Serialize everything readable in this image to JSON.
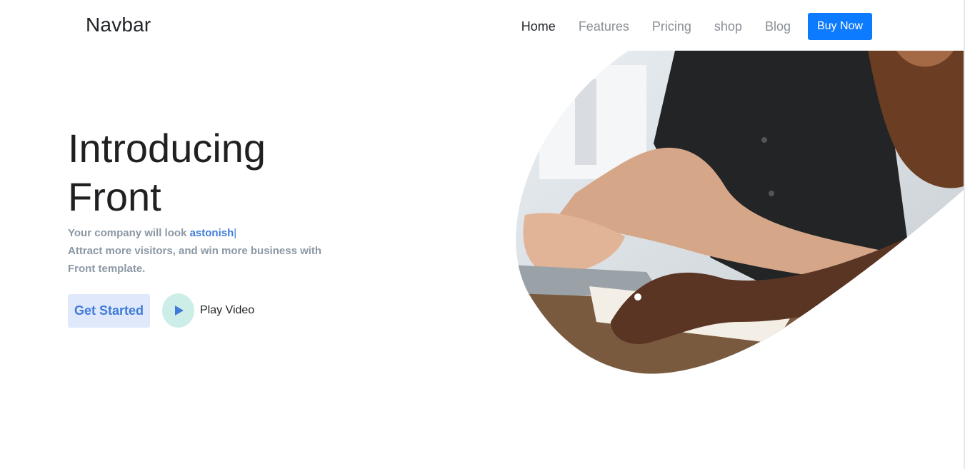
{
  "navbar": {
    "brand": "Navbar",
    "links": [
      {
        "label": "Home",
        "active": true
      },
      {
        "label": "Features",
        "active": false
      },
      {
        "label": "Pricing",
        "active": false
      },
      {
        "label": "shop",
        "active": false
      },
      {
        "label": "Blog",
        "active": false
      }
    ],
    "cta_label": "Buy Now"
  },
  "hero": {
    "title_line1": "Introducing",
    "title_line2": "Front",
    "tagline_prefix": "Your company will look",
    "tagline_word": "astonish",
    "tagline_cursor": "|",
    "description": "Attract more visitors, and win more business with Front template.",
    "primary_button": "Get Started",
    "video_label": "Play Video",
    "image_subject": "hands typing on laptop"
  },
  "colors": {
    "accent": "#3f7bd9",
    "cta": "#0d7bff",
    "muted_text": "#8c98a4",
    "play_bg": "#cdeee8"
  },
  "icons": {
    "play": "play-icon"
  }
}
